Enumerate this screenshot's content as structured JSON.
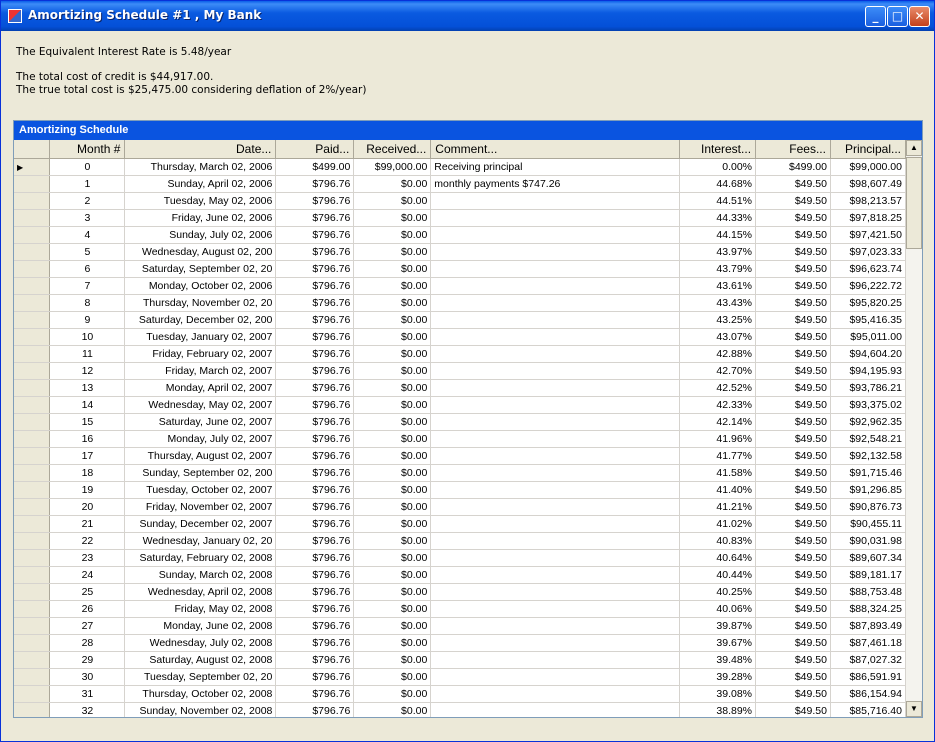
{
  "window": {
    "title": "Amortizing Schedule #1 , My Bank"
  },
  "info": {
    "line1": "The Equivalent Interest Rate is 5.48/year",
    "line2": "The total  cost  of credit is $44,917.00.",
    "line3": "The true total cost is $25,475.00 considering deflation of 2%/year)"
  },
  "grid": {
    "caption": "Amortizing Schedule",
    "columns": [
      "Month #",
      "Date...",
      "Paid...",
      "Received...",
      "Comment...",
      "Interest...",
      "Fees...",
      "Principal..."
    ],
    "rows": [
      [
        "0",
        "Thursday, March 02, 2006",
        "$499.00",
        "$99,000.00",
        "Receiving principal",
        "0.00%",
        "$499.00",
        "$99,000.00"
      ],
      [
        "1",
        "Sunday, April 02, 2006",
        "$796.76",
        "$0.00",
        "monthly payments $747.26",
        "44.68%",
        "$49.50",
        "$98,607.49"
      ],
      [
        "2",
        "Tuesday, May 02, 2006",
        "$796.76",
        "$0.00",
        "",
        "44.51%",
        "$49.50",
        "$98,213.57"
      ],
      [
        "3",
        "Friday, June 02, 2006",
        "$796.76",
        "$0.00",
        "",
        "44.33%",
        "$49.50",
        "$97,818.25"
      ],
      [
        "4",
        "Sunday, July 02, 2006",
        "$796.76",
        "$0.00",
        "",
        "44.15%",
        "$49.50",
        "$97,421.50"
      ],
      [
        "5",
        "Wednesday, August 02, 200",
        "$796.76",
        "$0.00",
        "",
        "43.97%",
        "$49.50",
        "$97,023.33"
      ],
      [
        "6",
        "Saturday, September 02, 20",
        "$796.76",
        "$0.00",
        "",
        "43.79%",
        "$49.50",
        "$96,623.74"
      ],
      [
        "7",
        "Monday, October 02, 2006",
        "$796.76",
        "$0.00",
        "",
        "43.61%",
        "$49.50",
        "$96,222.72"
      ],
      [
        "8",
        "Thursday, November 02, 20",
        "$796.76",
        "$0.00",
        "",
        "43.43%",
        "$49.50",
        "$95,820.25"
      ],
      [
        "9",
        "Saturday, December 02, 200",
        "$796.76",
        "$0.00",
        "",
        "43.25%",
        "$49.50",
        "$95,416.35"
      ],
      [
        "10",
        "Tuesday, January 02, 2007",
        "$796.76",
        "$0.00",
        "",
        "43.07%",
        "$49.50",
        "$95,011.00"
      ],
      [
        "11",
        "Friday, February 02, 2007",
        "$796.76",
        "$0.00",
        "",
        "42.88%",
        "$49.50",
        "$94,604.20"
      ],
      [
        "12",
        "Friday, March 02, 2007",
        "$796.76",
        "$0.00",
        "",
        "42.70%",
        "$49.50",
        "$94,195.93"
      ],
      [
        "13",
        "Monday, April 02, 2007",
        "$796.76",
        "$0.00",
        "",
        "42.52%",
        "$49.50",
        "$93,786.21"
      ],
      [
        "14",
        "Wednesday, May 02, 2007",
        "$796.76",
        "$0.00",
        "",
        "42.33%",
        "$49.50",
        "$93,375.02"
      ],
      [
        "15",
        "Saturday, June 02, 2007",
        "$796.76",
        "$0.00",
        "",
        "42.14%",
        "$49.50",
        "$92,962.35"
      ],
      [
        "16",
        "Monday, July 02, 2007",
        "$796.76",
        "$0.00",
        "",
        "41.96%",
        "$49.50",
        "$92,548.21"
      ],
      [
        "17",
        "Thursday, August 02, 2007",
        "$796.76",
        "$0.00",
        "",
        "41.77%",
        "$49.50",
        "$92,132.58"
      ],
      [
        "18",
        "Sunday, September 02, 200",
        "$796.76",
        "$0.00",
        "",
        "41.58%",
        "$49.50",
        "$91,715.46"
      ],
      [
        "19",
        "Tuesday, October 02, 2007",
        "$796.76",
        "$0.00",
        "",
        "41.40%",
        "$49.50",
        "$91,296.85"
      ],
      [
        "20",
        "Friday, November 02, 2007",
        "$796.76",
        "$0.00",
        "",
        "41.21%",
        "$49.50",
        "$90,876.73"
      ],
      [
        "21",
        "Sunday, December 02, 2007",
        "$796.76",
        "$0.00",
        "",
        "41.02%",
        "$49.50",
        "$90,455.11"
      ],
      [
        "22",
        "Wednesday, January 02, 20",
        "$796.76",
        "$0.00",
        "",
        "40.83%",
        "$49.50",
        "$90,031.98"
      ],
      [
        "23",
        "Saturday, February 02, 2008",
        "$796.76",
        "$0.00",
        "",
        "40.64%",
        "$49.50",
        "$89,607.34"
      ],
      [
        "24",
        "Sunday, March 02, 2008",
        "$796.76",
        "$0.00",
        "",
        "40.44%",
        "$49.50",
        "$89,181.17"
      ],
      [
        "25",
        "Wednesday, April 02, 2008",
        "$796.76",
        "$0.00",
        "",
        "40.25%",
        "$49.50",
        "$88,753.48"
      ],
      [
        "26",
        "Friday, May 02, 2008",
        "$796.76",
        "$0.00",
        "",
        "40.06%",
        "$49.50",
        "$88,324.25"
      ],
      [
        "27",
        "Monday, June 02, 2008",
        "$796.76",
        "$0.00",
        "",
        "39.87%",
        "$49.50",
        "$87,893.49"
      ],
      [
        "28",
        "Wednesday, July 02, 2008",
        "$796.76",
        "$0.00",
        "",
        "39.67%",
        "$49.50",
        "$87,461.18"
      ],
      [
        "29",
        "Saturday, August 02, 2008",
        "$796.76",
        "$0.00",
        "",
        "39.48%",
        "$49.50",
        "$87,027.32"
      ],
      [
        "30",
        "Tuesday, September 02, 20",
        "$796.76",
        "$0.00",
        "",
        "39.28%",
        "$49.50",
        "$86,591.91"
      ],
      [
        "31",
        "Thursday, October 02, 2008",
        "$796.76",
        "$0.00",
        "",
        "39.08%",
        "$49.50",
        "$86,154.94"
      ],
      [
        "32",
        "Sunday, November 02, 2008",
        "$796.76",
        "$0.00",
        "",
        "38.89%",
        "$49.50",
        "$85,716.40"
      ]
    ]
  }
}
